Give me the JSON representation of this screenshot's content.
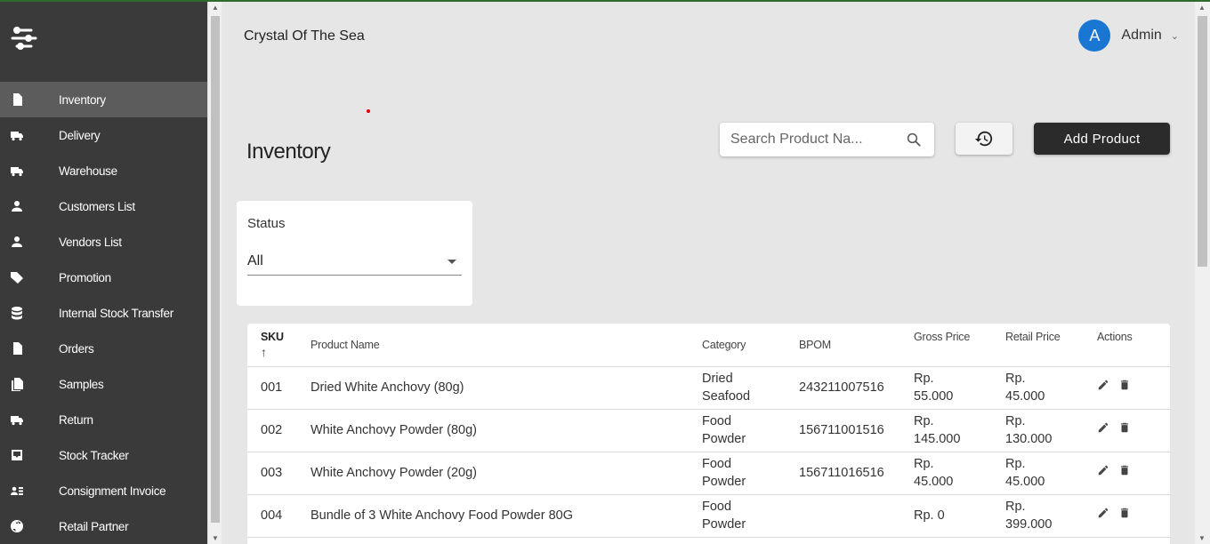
{
  "sidebar": {
    "items": [
      {
        "label": "Inventory",
        "icon": "document-icon",
        "active": true
      },
      {
        "label": "Delivery",
        "icon": "truck-icon"
      },
      {
        "label": "Warehouse",
        "icon": "truck-icon"
      },
      {
        "label": "Customers List",
        "icon": "person-icon"
      },
      {
        "label": "Vendors List",
        "icon": "person-icon"
      },
      {
        "label": "Promotion",
        "icon": "tag-icon"
      },
      {
        "label": "Internal Stock Transfer",
        "icon": "database-icon"
      },
      {
        "label": "Orders",
        "icon": "document-icon"
      },
      {
        "label": "Samples",
        "icon": "documents-icon"
      },
      {
        "label": "Return",
        "icon": "truck-icon"
      },
      {
        "label": "Stock Tracker",
        "icon": "inbox-icon"
      },
      {
        "label": "Consignment Invoice",
        "icon": "contact-card-icon"
      },
      {
        "label": "Retail Partner",
        "icon": "globe-icon"
      }
    ]
  },
  "header": {
    "shop_name": "Crystal Of The Sea",
    "avatar_initial": "A",
    "user_name": "Admin"
  },
  "page": {
    "title": "Inventory",
    "search_placeholder": "Search Product Na...",
    "add_button": "Add Product"
  },
  "filter": {
    "label": "Status",
    "value": "All"
  },
  "table": {
    "columns": [
      "SKU",
      "Product Name",
      "Category",
      "BPOM",
      "Gross Price",
      "Retail Price",
      "Actions"
    ],
    "rows": [
      {
        "sku": "001",
        "name": "Dried White Anchovy (80g)",
        "category": "Dried Seafood",
        "bpom": "243211007516",
        "gross": "Rp. 55.000",
        "retail": "Rp. 45.000"
      },
      {
        "sku": "002",
        "name": "White Anchovy Powder (80g)",
        "category": "Food Powder",
        "bpom": "156711001516",
        "gross": "Rp. 145.000",
        "retail": "Rp. 130.000"
      },
      {
        "sku": "003",
        "name": "White Anchovy Powder (20g)",
        "category": "Food Powder",
        "bpom": "156711016516",
        "gross": "Rp. 45.000",
        "retail": "Rp. 45.000"
      },
      {
        "sku": "004",
        "name": "Bundle of 3 White Anchovy Food Powder 80G",
        "category": "Food Powder",
        "bpom": "",
        "gross": "Rp. 0",
        "retail": "Rp. 399.000"
      }
    ]
  },
  "colors": {
    "sidebar_bg": "#3a3a3a",
    "sidebar_active": "#5c5c5c",
    "avatar_bg": "#1976d2",
    "primary_button": "#2b2b2b"
  }
}
